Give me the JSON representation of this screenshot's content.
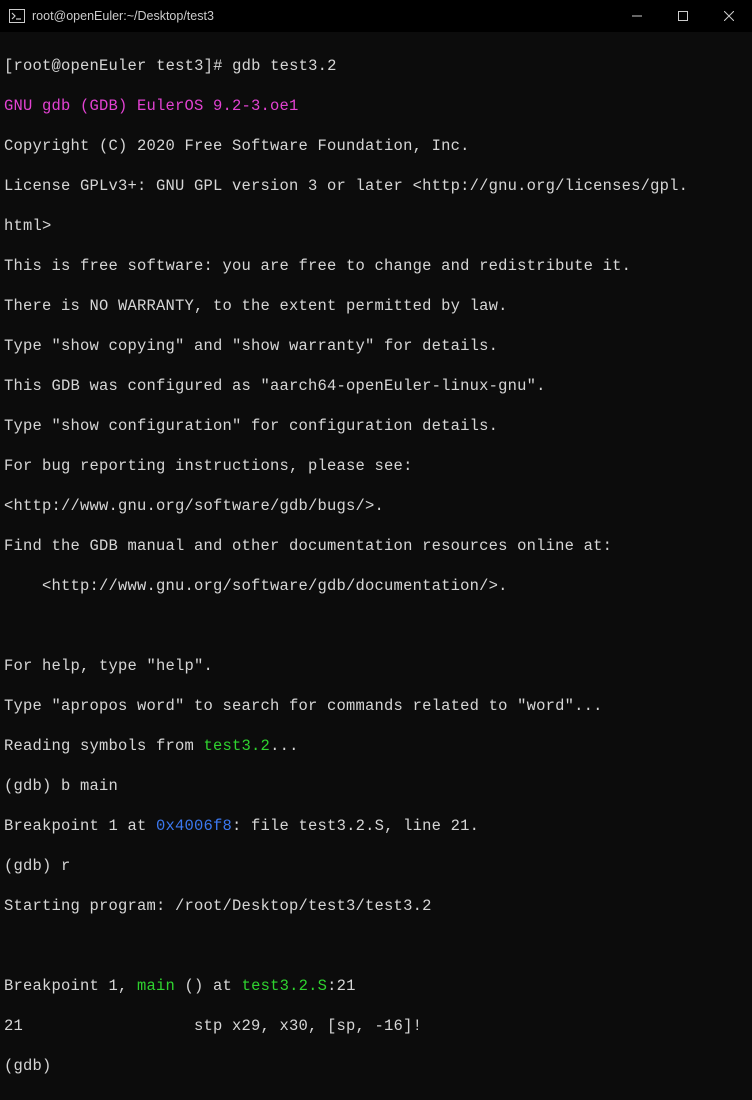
{
  "window": {
    "title": "root@openEuler:~/Desktop/test3"
  },
  "terminal": {
    "prompt_open": "[",
    "prompt_user": "root@openEuler",
    "prompt_space": " ",
    "prompt_dir": "test3",
    "prompt_close": "]# ",
    "cmd_gdb": "gdb test3.2",
    "l2_a": "GNU gdb (GDB) ",
    "l2_b": "EulerOS 9.2-3.oe1",
    "l3": "Copyright (C) 2020 Free Software Foundation, Inc.",
    "l4": "License GPLv3+: GNU GPL version 3 or later <http://gnu.org/licenses/gpl.",
    "l5": "html>",
    "l6": "This is free software: you are free to change and redistribute it.",
    "l7": "There is NO WARRANTY, to the extent permitted by law.",
    "l8": "Type \"show copying\" and \"show warranty\" for details.",
    "l9": "This GDB was configured as \"aarch64-openEuler-linux-gnu\".",
    "l10": "Type \"show configuration\" for configuration details.",
    "l11": "For bug reporting instructions, please see:",
    "l12": "<http://www.gnu.org/software/gdb/bugs/>.",
    "l13": "Find the GDB manual and other documentation resources online at:",
    "l14": "    <http://www.gnu.org/software/gdb/documentation/>.",
    "l15": "",
    "l16": "For help, type \"help\".",
    "l17": "Type \"apropos word\" to search for commands related to \"word\"...",
    "l18_a": "Reading symbols from ",
    "l18_b": "test3.2",
    "l18_c": "...",
    "l19_a": "(gdb) b main",
    "l20_a": "Breakpoint 1 at ",
    "l20_b": "0x4006f8",
    "l20_c": ": file test3.2.S, line 21.",
    "l21": "(gdb) r",
    "l22": "Starting program: /root/Desktop/test3/test3.2",
    "l23": "",
    "l24_a": "Breakpoint 1, ",
    "l24_b": "main",
    "l24_c": " () at ",
    "l24_d": "test3.2.S",
    "l24_e": ":21",
    "l25": "21                  stp x29, x30, [sp, -16]!",
    "l26": "(gdb) "
  }
}
